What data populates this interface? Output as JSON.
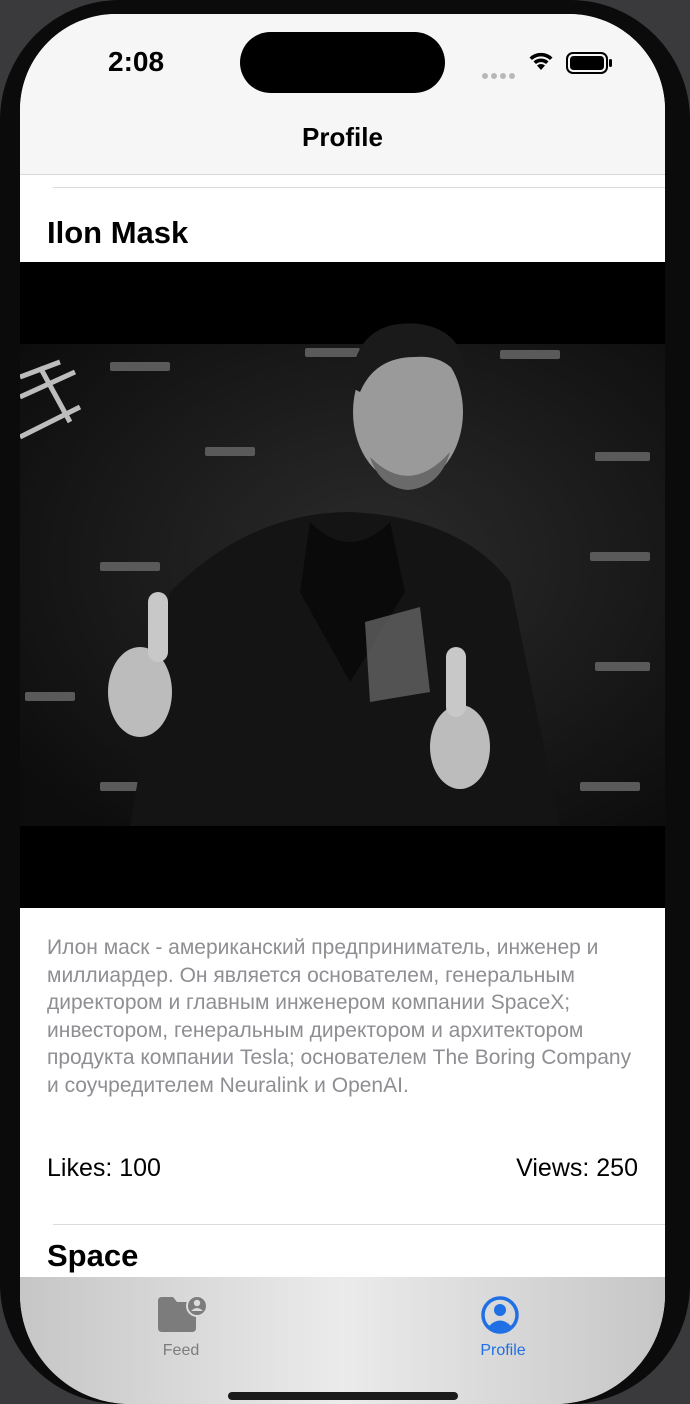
{
  "status_bar": {
    "time": "2:08",
    "icons": [
      "signal-dots-icon",
      "wifi-icon",
      "battery-icon"
    ]
  },
  "nav": {
    "title": "Profile"
  },
  "post": {
    "author": "Ilon Mask",
    "image_alt": "photo",
    "text": "Илон маск - американский предприниматель, инженер и миллиардер. Он является основателем, генеральным директором и главным инженером компании SpaceX; инвестором, генеральным директором и архитектором продукта компании Tesla; основателем The Boring Company и соучредителем Neuralink и OpenAI.",
    "likes": "Likes: 100",
    "views": "Views: 250"
  },
  "next_post": {
    "author": "Space"
  },
  "tab_bar": {
    "tabs": [
      {
        "label": "Feed",
        "icon": "folder-person-icon",
        "selected": false
      },
      {
        "label": "Profile",
        "icon": "person-circle-icon",
        "selected": true
      }
    ],
    "accent": "#1f6fe5",
    "inactive": "#7c7c7c"
  }
}
